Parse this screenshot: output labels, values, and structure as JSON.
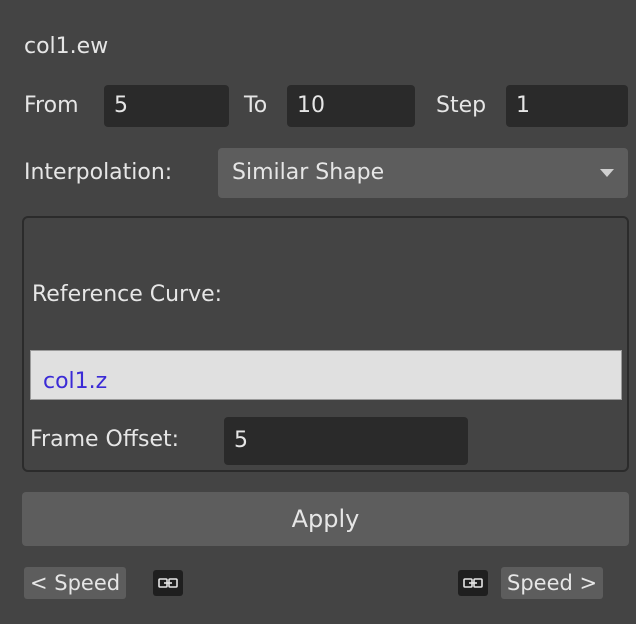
{
  "title": "col1.ew",
  "range": {
    "from_label": "From",
    "from_value": "5",
    "to_label": "To",
    "to_value": "10",
    "step_label": "Step",
    "step_value": "1"
  },
  "interpolation": {
    "label": "Interpolation:",
    "selected": "Similar Shape",
    "arrow_icon": "chevron-down-icon"
  },
  "reference": {
    "label": "Reference Curve:",
    "curve": "col1.z",
    "curve_color": "#3b2bd6",
    "offset_label": "Frame Offset:",
    "offset_value": "5"
  },
  "apply_label": "Apply",
  "speed": {
    "left_label": "< Speed",
    "right_label": "Speed >",
    "link_icon": "link-icon"
  }
}
